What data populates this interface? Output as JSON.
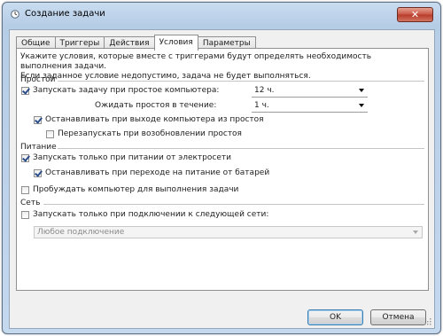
{
  "window": {
    "title": "Создание задачи",
    "close_label": "✕"
  },
  "tabs": [
    {
      "label": "Общие"
    },
    {
      "label": "Триггеры"
    },
    {
      "label": "Действия"
    },
    {
      "label": "Условия",
      "active": true
    },
    {
      "label": "Параметры"
    }
  ],
  "conditions": {
    "description_line1": "Укажите условия, которые вместе с триггерами будут определять необходимость выполнения задачи.",
    "description_line2": "Если заданное условие недопустимо, задача не будет выполняться.",
    "idle": {
      "section": "Простой",
      "start_if_idle": {
        "label": "Запускать задачу при простое компьютера:",
        "checked": true
      },
      "idle_duration_value": "12 ч.",
      "wait_label": "Ожидать простоя в течение:",
      "wait_value": "1 ч.",
      "stop_on_idle_end": {
        "label": "Останавливать при выходе компьютера из простоя",
        "checked": true
      },
      "restart_on_idle_resume": {
        "label": "Перезапускать при возобновлении простоя",
        "checked": false
      }
    },
    "power": {
      "section": "Питание",
      "ac_only": {
        "label": "Запускать только при питании от электросети",
        "checked": true
      },
      "stop_on_battery": {
        "label": "Останавливать при переходе на питание от батарей",
        "checked": true
      },
      "wake_to_run": {
        "label": "Пробуждать компьютер для выполнения задачи",
        "checked": false
      }
    },
    "network": {
      "section": "Сеть",
      "network_condition": {
        "label": "Запускать только при подключении к следующей сети:",
        "checked": false
      },
      "network_value": "Любое подключение"
    }
  },
  "buttons": {
    "ok": "OK",
    "cancel": "Отмена"
  },
  "icons": {
    "title": "clock-icon",
    "dropdown": "chevron-down-icon"
  }
}
